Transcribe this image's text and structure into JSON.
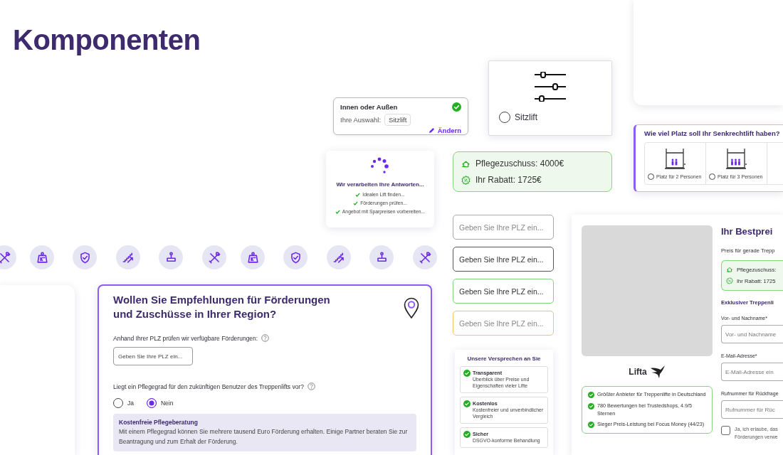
{
  "heading": "Komponenten",
  "summary_card": {
    "title": "Innen oder Außen",
    "done": true,
    "label": "Ihre Auswahl:",
    "choice": "Sitzlift",
    "edit_link": "Ändern"
  },
  "option_card": {
    "label": "Sitzlift",
    "selected": false
  },
  "loading_card": {
    "title": "Wir verarbeiten Ihre Antworten...",
    "steps": [
      {
        "text": "Idealen Lift finden...",
        "done": true
      },
      {
        "text": "Förderungen prüfen...",
        "done": true
      },
      {
        "text": "Angebot mit Sparpreisen vorbereiten...",
        "done": true
      }
    ]
  },
  "subsidy_card": {
    "rows": [
      {
        "kind": "care",
        "text": "Pflegezuschuss: 4000€"
      },
      {
        "kind": "discount",
        "text": "Ihr Rabatt: 1725€"
      }
    ]
  },
  "space_card": {
    "title": "Wie viel Platz soll Ihr Senkrechtlift haben?",
    "options": [
      {
        "label": "Platz für 2 Personen",
        "selected": false
      },
      {
        "label": "Platz für 3 Personen",
        "selected": false
      }
    ]
  },
  "region_form": {
    "title_lines": [
      "Wollen Sie Empfehlungen für Förderungen",
      "und Zuschüsse in Ihrer Region?"
    ],
    "plz_label": "Anhand Ihrer PLZ prüfen wir verfügbare Förderungen:",
    "plz_placeholder": "Geben Sie Ihre PLZ ein...",
    "question": "Liegt ein Pflegegrad für den zukünftigen Benutzer des Treppenlifts vor?",
    "answers": [
      {
        "label": "Ja",
        "selected": false
      },
      {
        "label": "Nein",
        "selected": true
      }
    ],
    "info": {
      "title": "Kostenfreie Pflegeberatung",
      "text": "Mit einem Pflegegrad können Sie mehrere tausend Euro Förderung erhalten. Einige Partner beraten Sie zur Beantragung und zum Erhalt der Förderung."
    }
  },
  "field_states": [
    {
      "kind": "default",
      "placeholder": "Geben Sie Ihre PLZ ein..."
    },
    {
      "kind": "focused",
      "value": "Geben Sie Ihre PLZ ein..."
    },
    {
      "kind": "valid",
      "value": "Geben Sie Ihre PLZ ein..."
    },
    {
      "kind": "warning",
      "placeholder": "Geben Sie Ihre PLZ ein..."
    }
  ],
  "promises": {
    "title": "Unsere Versprechen an Sie",
    "items": [
      {
        "title": "Transparent",
        "text": "Überblick über Preise und Eigenschaften vieler Lifte"
      },
      {
        "title": "Kostenlos",
        "text": "Kostenfreier und unverbindlicher Vergleich"
      },
      {
        "title": "Sicher",
        "text": "DSGVO-konforme Behandlung"
      }
    ]
  },
  "offer": {
    "brand": "Lifta",
    "benefits": [
      "Größter Anbieter für Treppenlifte in Deutschland",
      "780 Bewertungen bei Trustedshops, 4.9/5 Sternen",
      "Sieger Preis-Leistung bei Focus Money (44/23)"
    ],
    "title": "Ihr Bestprei",
    "subtitle": "Preis für gerade Trepp",
    "subsidy_rows": [
      {
        "kind": "care",
        "text": "Pflegezuschuss:"
      },
      {
        "kind": "discount",
        "text": "Ihr Rabatt: 1725"
      }
    ],
    "section": "Exklusiver Treppenli",
    "fields": [
      {
        "label": "Vor- und Nachname*",
        "placeholder": "Vor- und Nachname"
      },
      {
        "label": "E-Mail-Adresse*",
        "placeholder": "E-Mail-Adresse ein"
      },
      {
        "label": "Rufnummer für Rückfrage",
        "placeholder": "Rufnummer für Rüc"
      }
    ],
    "consent": {
      "checked": false,
      "text_lines": [
        "Ja, ich erlaube, das",
        "Förderungen verwe"
      ]
    }
  }
}
